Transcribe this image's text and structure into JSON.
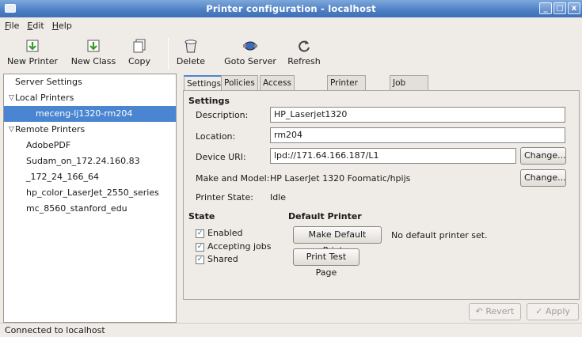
{
  "window": {
    "title": "Printer configuration - localhost",
    "controls": [
      "_",
      "□",
      "x"
    ]
  },
  "menu": [
    "File",
    "Edit",
    "Help"
  ],
  "toolbar": {
    "new_printer": "New Printer",
    "new_class": "New Class",
    "copy": "Copy",
    "delete": "Delete",
    "goto_server": "Goto Server",
    "refresh": "Refresh"
  },
  "tree": {
    "server_settings": "Server Settings",
    "local_printers": "Local Printers",
    "local_items": [
      "meceng-lj1320-rm204"
    ],
    "remote_printers": "Remote Printers",
    "remote_items": [
      "AdobePDF",
      "Sudam_on_172.24.160.83",
      "_172_24_166_64",
      "hp_color_LaserJet_2550_series",
      "mc_8560_stanford_edu"
    ]
  },
  "tabs": [
    "Settings",
    "Policies",
    "Access control",
    "Printer Options",
    "Job Options"
  ],
  "settings": {
    "heading": "Settings",
    "description_label": "Description:",
    "description_value": "HP_Laserjet1320",
    "location_label": "Location:",
    "location_value": "rm204",
    "device_uri_label": "Device URI:",
    "device_uri_value": "lpd://171.64.166.187/L1",
    "change": "Change...",
    "make_model_label": "Make and Model:",
    "make_model_value": "HP LaserJet 1320 Foomatic/hpijs",
    "printer_state_label": "Printer State:",
    "printer_state_value": "Idle"
  },
  "state": {
    "heading": "State",
    "enabled": "Enabled",
    "accepting_jobs": "Accepting jobs",
    "shared": "Shared"
  },
  "default_printer": {
    "heading": "Default Printer",
    "make_default": "Make Default Printer",
    "no_default": "No default printer set.",
    "print_test": "Print Test Page"
  },
  "actions": {
    "revert": "Revert",
    "apply": "Apply"
  },
  "status": "Connected to localhost"
}
